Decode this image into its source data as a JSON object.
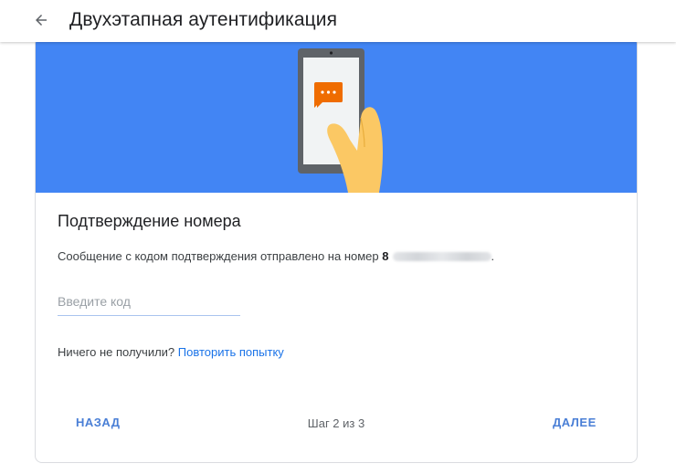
{
  "header": {
    "title": "Двухэтапная аутентификация",
    "back_icon": "arrow-back-icon"
  },
  "banner": {
    "illustration": "phone-with-message-icon",
    "colors": {
      "background": "#4285f4",
      "phone": "#5f6368",
      "screen": "#f1f3f4",
      "message_bubble": "#ef6c00",
      "hand": "#fbc864"
    }
  },
  "verification": {
    "title": "Подтверждение номера",
    "message": "Сообщение с кодом подтверждения отправлено на номер",
    "phone_prefix": "8",
    "code_input": {
      "placeholder": "Введите код",
      "value": ""
    },
    "resend_question": "Ничего не получили?",
    "resend_link": "Повторить попытку"
  },
  "footer": {
    "back_label": "НАЗАД",
    "step_label": "Шаг 2 из 3",
    "next_label": "ДАЛЕЕ"
  },
  "colors": {
    "accent": "#1a73e8",
    "button_text": "#4a7fd6",
    "input_underline": "#a9c4ef"
  }
}
